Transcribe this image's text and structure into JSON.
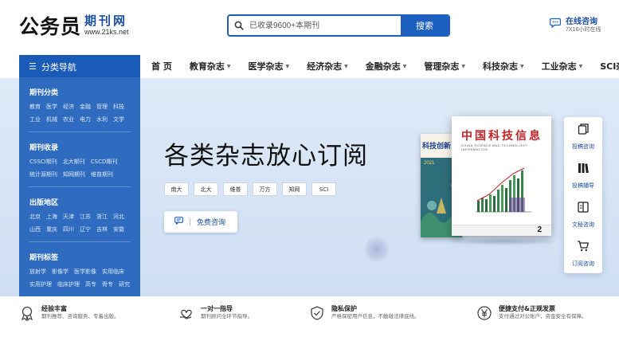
{
  "header": {
    "logo_main": "公务员",
    "logo_sub": "期刊网",
    "logo_url": "www.21ks.net",
    "search_placeholder": "已收录9600+本期刊",
    "search_button": "搜索",
    "consult_title": "在线咨询",
    "consult_sub": "7X16小时在线"
  },
  "nav": {
    "category_label": "分类导航",
    "items": [
      "首 页",
      "教育杂志",
      "医学杂志",
      "经济杂志",
      "金融杂志",
      "管理杂志",
      "科技杂志",
      "工业杂志",
      "SCI杂志"
    ]
  },
  "sidebar": {
    "sections": [
      {
        "title": "期刊分类",
        "rows": [
          [
            "教育",
            "医学",
            "经济",
            "金融",
            "管理",
            "科技"
          ],
          [
            "工业",
            "机械",
            "农业",
            "电力",
            "水利",
            "文学"
          ]
        ]
      },
      {
        "title": "期刊收录",
        "rows": [
          [
            "CSSCI期刊",
            "北大期刊",
            "CSCD期刊"
          ],
          [
            "统计源期刊",
            "知网期刊",
            "维普期刊"
          ]
        ]
      },
      {
        "title": "出版地区",
        "rows": [
          [
            "北京",
            "上海",
            "天津",
            "江苏",
            "浙江",
            "河北"
          ],
          [
            "山西",
            "重庆",
            "四川",
            "辽宁",
            "吉林",
            "安徽"
          ]
        ]
      },
      {
        "title": "期刊标签",
        "rows": [
          [
            "放射学",
            "影像学",
            "医学影像",
            "实用临床"
          ],
          [
            "实用护理",
            "临床护理",
            "高专",
            "骨专",
            "研究"
          ]
        ]
      }
    ]
  },
  "hero": {
    "title": "各类杂志放心订阅",
    "tags": [
      "南大",
      "北大",
      "维普",
      "万方",
      "知网",
      "SCI"
    ],
    "free_consult": "免费咨询"
  },
  "magazines": {
    "front_title": "中国科技信息",
    "front_sub": "CHINA SCIENCE AND TECHNOLOGY INFORMATION",
    "front_issue": "2",
    "back_title": "科技创新",
    "back_year": "2021",
    "back_num": "6"
  },
  "float_bar": {
    "items": [
      "投稿咨询",
      "投稿辅导",
      "文秘咨询",
      "订阅咨询"
    ]
  },
  "features": [
    {
      "title": "经验丰富",
      "desc": "期刊推荐、咨询服务、专着出版。"
    },
    {
      "title": "一对一指导",
      "desc": "期刊顾问全环节指导。"
    },
    {
      "title": "隐私保护",
      "desc": "严格保密用户信息，不触碰法律底线。"
    },
    {
      "title": "便捷支付&正规发票",
      "desc": "支付通过对公账户，资金安全有保障。"
    }
  ],
  "colors": {
    "brand_blue": "#1d5fbf",
    "sidebar_blue": "#2f6bbf",
    "banner_bg": "#d8e5f6",
    "accent_red": "#c0232a"
  }
}
